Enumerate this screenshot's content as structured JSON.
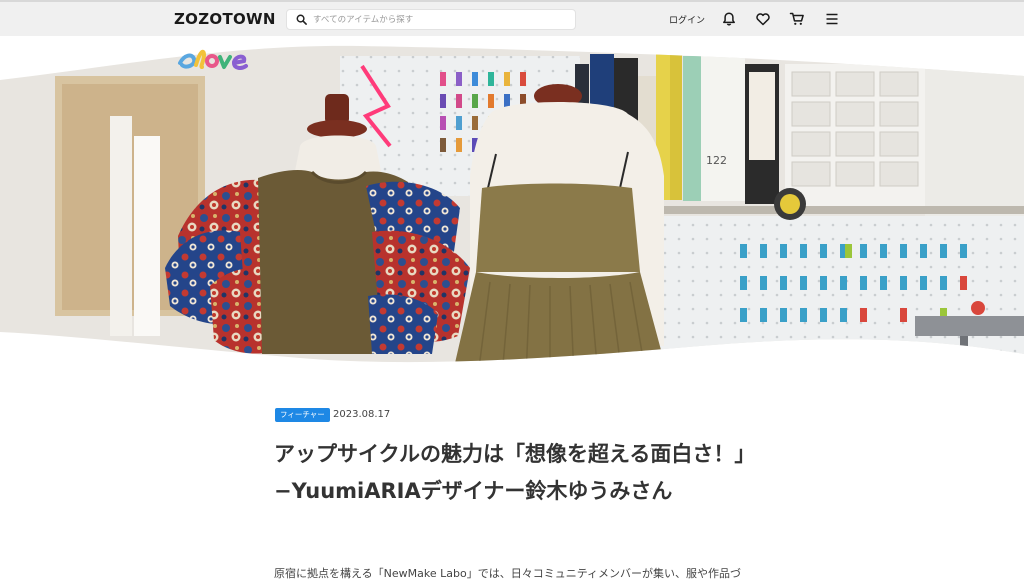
{
  "header": {
    "logo": "ZOZOTOWN",
    "search_placeholder": "すべてのアイテムから探す",
    "login_label": "ログイン",
    "icons": [
      "bell-icon",
      "heart-icon",
      "cart-icon",
      "menu-icon"
    ]
  },
  "hero": {
    "brand_logo": "elove"
  },
  "article": {
    "category_badge": "フィーチャー",
    "date": "2023.08.17",
    "title": "アップサイクルの魅力は「想像を超える面白さ！」−YuumiARIAデザイナー鈴木ゆうみさん",
    "lead": "原宿に拠点を構える「NewMake Labo」では、日々コミュニティメンバーが集い、服や作品づ"
  },
  "colors": {
    "accent": "#1e88e5",
    "header_bg": "#f0f0f0",
    "text": "#333333"
  }
}
